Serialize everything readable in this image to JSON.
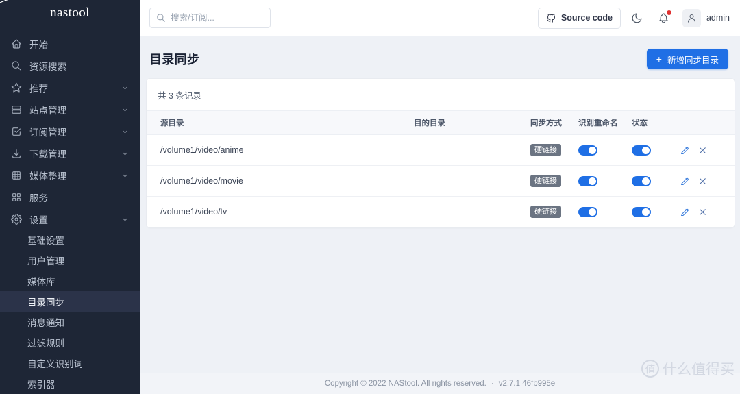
{
  "sidebar": {
    "brand": "nastool",
    "items": [
      {
        "label": "开始",
        "icon": "home-icon",
        "expandable": false
      },
      {
        "label": "资源搜索",
        "icon": "search-icon",
        "expandable": false
      },
      {
        "label": "推荐",
        "icon": "star-icon",
        "expandable": true
      },
      {
        "label": "站点管理",
        "icon": "server-icon",
        "expandable": true
      },
      {
        "label": "订阅管理",
        "icon": "checkbox-icon",
        "expandable": true
      },
      {
        "label": "下载管理",
        "icon": "download-icon",
        "expandable": true
      },
      {
        "label": "媒体整理",
        "icon": "layout-grid-icon",
        "expandable": true
      },
      {
        "label": "服务",
        "icon": "apps-icon",
        "expandable": false
      },
      {
        "label": "设置",
        "icon": "gear-icon",
        "expandable": true
      }
    ],
    "settings_children": [
      {
        "label": "基础设置",
        "active": false
      },
      {
        "label": "用户管理",
        "active": false
      },
      {
        "label": "媒体库",
        "active": false
      },
      {
        "label": "目录同步",
        "active": true
      },
      {
        "label": "消息通知",
        "active": false
      },
      {
        "label": "过滤规则",
        "active": false
      },
      {
        "label": "自定义识别词",
        "active": false
      },
      {
        "label": "索引器",
        "active": false
      }
    ]
  },
  "topbar": {
    "search_placeholder": "搜索/订阅...",
    "search_value": "",
    "source_code_label": "Source code",
    "username": "admin"
  },
  "page": {
    "title": "目录同步",
    "add_button_label": "新增同步目录",
    "add_button_plus": "+"
  },
  "table": {
    "record_count_text": "共 3 条记录",
    "columns": [
      "源目录",
      "目的目录",
      "同步方式",
      "识别重命名",
      "状态"
    ],
    "rows": [
      {
        "source": "/volume1/video/anime",
        "target": "",
        "mode": "硬链接",
        "rename": true,
        "status": true
      },
      {
        "source": "/volume1/video/movie",
        "target": "",
        "mode": "硬链接",
        "rename": true,
        "status": true
      },
      {
        "source": "/volume1/video/tv",
        "target": "",
        "mode": "硬链接",
        "rename": true,
        "status": true
      }
    ]
  },
  "footer": {
    "copyright": "Copyright © 2022 NAStool. All rights reserved.",
    "separator": "·",
    "version": "v2.7.1 46fb995e",
    "watermark_mark": "值",
    "watermark_text": "什么值得买"
  },
  "colors": {
    "sidebar_bg": "#1e2636",
    "sidebar_active": "#2b3349",
    "accent": "#1f6fe5",
    "page_bg": "#eef1f6",
    "badge_gray": "#6b7482",
    "notify_dot": "#e03131"
  }
}
